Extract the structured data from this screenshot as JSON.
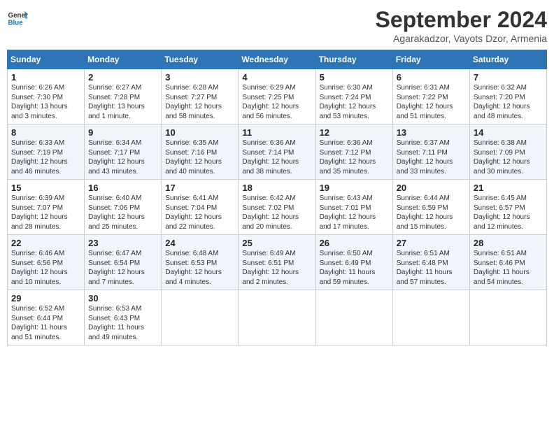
{
  "header": {
    "logo_line1": "General",
    "logo_line2": "Blue",
    "month": "September 2024",
    "location": "Agarakadzor, Vayots Dzor, Armenia"
  },
  "weekdays": [
    "Sunday",
    "Monday",
    "Tuesday",
    "Wednesday",
    "Thursday",
    "Friday",
    "Saturday"
  ],
  "weeks": [
    [
      {
        "day": "1",
        "sunrise": "6:26 AM",
        "sunset": "7:30 PM",
        "daylight": "13 hours and 3 minutes."
      },
      {
        "day": "2",
        "sunrise": "6:27 AM",
        "sunset": "7:28 PM",
        "daylight": "13 hours and 1 minute."
      },
      {
        "day": "3",
        "sunrise": "6:28 AM",
        "sunset": "7:27 PM",
        "daylight": "12 hours and 58 minutes."
      },
      {
        "day": "4",
        "sunrise": "6:29 AM",
        "sunset": "7:25 PM",
        "daylight": "12 hours and 56 minutes."
      },
      {
        "day": "5",
        "sunrise": "6:30 AM",
        "sunset": "7:24 PM",
        "daylight": "12 hours and 53 minutes."
      },
      {
        "day": "6",
        "sunrise": "6:31 AM",
        "sunset": "7:22 PM",
        "daylight": "12 hours and 51 minutes."
      },
      {
        "day": "7",
        "sunrise": "6:32 AM",
        "sunset": "7:20 PM",
        "daylight": "12 hours and 48 minutes."
      }
    ],
    [
      {
        "day": "8",
        "sunrise": "6:33 AM",
        "sunset": "7:19 PM",
        "daylight": "12 hours and 46 minutes."
      },
      {
        "day": "9",
        "sunrise": "6:34 AM",
        "sunset": "7:17 PM",
        "daylight": "12 hours and 43 minutes."
      },
      {
        "day": "10",
        "sunrise": "6:35 AM",
        "sunset": "7:16 PM",
        "daylight": "12 hours and 40 minutes."
      },
      {
        "day": "11",
        "sunrise": "6:36 AM",
        "sunset": "7:14 PM",
        "daylight": "12 hours and 38 minutes."
      },
      {
        "day": "12",
        "sunrise": "6:36 AM",
        "sunset": "7:12 PM",
        "daylight": "12 hours and 35 minutes."
      },
      {
        "day": "13",
        "sunrise": "6:37 AM",
        "sunset": "7:11 PM",
        "daylight": "12 hours and 33 minutes."
      },
      {
        "day": "14",
        "sunrise": "6:38 AM",
        "sunset": "7:09 PM",
        "daylight": "12 hours and 30 minutes."
      }
    ],
    [
      {
        "day": "15",
        "sunrise": "6:39 AM",
        "sunset": "7:07 PM",
        "daylight": "12 hours and 28 minutes."
      },
      {
        "day": "16",
        "sunrise": "6:40 AM",
        "sunset": "7:06 PM",
        "daylight": "12 hours and 25 minutes."
      },
      {
        "day": "17",
        "sunrise": "6:41 AM",
        "sunset": "7:04 PM",
        "daylight": "12 hours and 22 minutes."
      },
      {
        "day": "18",
        "sunrise": "6:42 AM",
        "sunset": "7:02 PM",
        "daylight": "12 hours and 20 minutes."
      },
      {
        "day": "19",
        "sunrise": "6:43 AM",
        "sunset": "7:01 PM",
        "daylight": "12 hours and 17 minutes."
      },
      {
        "day": "20",
        "sunrise": "6:44 AM",
        "sunset": "6:59 PM",
        "daylight": "12 hours and 15 minutes."
      },
      {
        "day": "21",
        "sunrise": "6:45 AM",
        "sunset": "6:57 PM",
        "daylight": "12 hours and 12 minutes."
      }
    ],
    [
      {
        "day": "22",
        "sunrise": "6:46 AM",
        "sunset": "6:56 PM",
        "daylight": "12 hours and 10 minutes."
      },
      {
        "day": "23",
        "sunrise": "6:47 AM",
        "sunset": "6:54 PM",
        "daylight": "12 hours and 7 minutes."
      },
      {
        "day": "24",
        "sunrise": "6:48 AM",
        "sunset": "6:53 PM",
        "daylight": "12 hours and 4 minutes."
      },
      {
        "day": "25",
        "sunrise": "6:49 AM",
        "sunset": "6:51 PM",
        "daylight": "12 hours and 2 minutes."
      },
      {
        "day": "26",
        "sunrise": "6:50 AM",
        "sunset": "6:49 PM",
        "daylight": "11 hours and 59 minutes."
      },
      {
        "day": "27",
        "sunrise": "6:51 AM",
        "sunset": "6:48 PM",
        "daylight": "11 hours and 57 minutes."
      },
      {
        "day": "28",
        "sunrise": "6:51 AM",
        "sunset": "6:46 PM",
        "daylight": "11 hours and 54 minutes."
      }
    ],
    [
      {
        "day": "29",
        "sunrise": "6:52 AM",
        "sunset": "6:44 PM",
        "daylight": "11 hours and 51 minutes."
      },
      {
        "day": "30",
        "sunrise": "6:53 AM",
        "sunset": "6:43 PM",
        "daylight": "11 hours and 49 minutes."
      },
      null,
      null,
      null,
      null,
      null
    ]
  ]
}
